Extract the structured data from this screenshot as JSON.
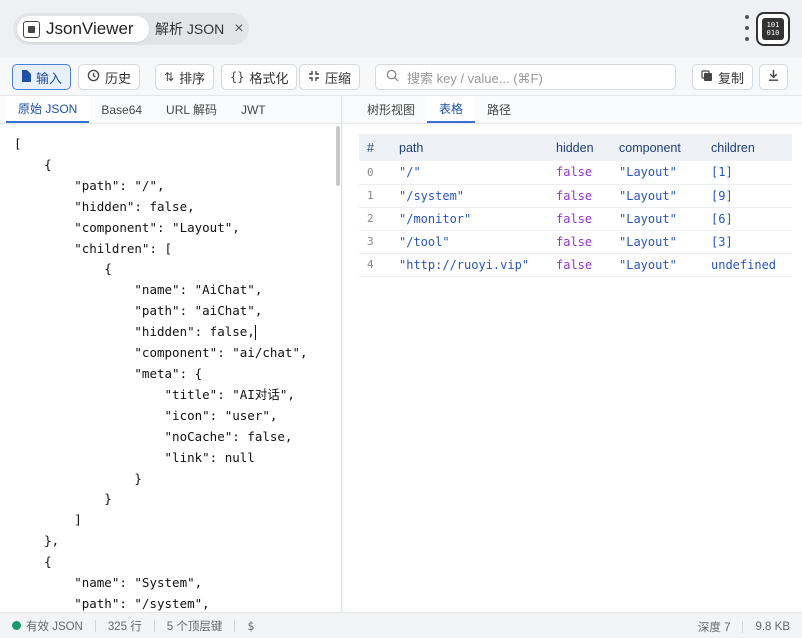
{
  "titlebar": {
    "app_title": "JsonViewer",
    "doc_tab": "解析 JSON",
    "close_glyph": "×"
  },
  "toolbar": {
    "input": "输入",
    "history": "历史",
    "sort": "排序",
    "format": "格式化",
    "compress": "压缩",
    "search_placeholder": "搜索 key / value... (⌘F)",
    "copy": "复制"
  },
  "left_tabs": [
    "原始 JSON",
    "Base64",
    "URL 解码",
    "JWT"
  ],
  "right_tabs": [
    "树形视图",
    "表格",
    "路径"
  ],
  "code_lines": [
    "[",
    "    {",
    "        \"path\": \"/\",",
    "        \"hidden\": false,",
    "        \"component\": \"Layout\",",
    "        \"children\": [",
    "            {",
    "                \"name\": \"AiChat\",",
    "                \"path\": \"aiChat\",",
    "                \"hidden\": false,",
    "                \"component\": \"ai/chat\",",
    "                \"meta\": {",
    "                    \"title\": \"AI对话\",",
    "                    \"icon\": \"user\",",
    "                    \"noCache\": false,",
    "                    \"link\": null",
    "                }",
    "            }",
    "        ]",
    "    },",
    "    {",
    "        \"name\": \"System\",",
    "        \"path\": \"/system\","
  ],
  "table": {
    "headers": [
      "#",
      "path",
      "hidden",
      "component",
      "children"
    ],
    "rows": [
      [
        "0",
        "\"/\"",
        "false",
        "\"Layout\"",
        "[1]"
      ],
      [
        "1",
        "\"/system\"",
        "false",
        "\"Layout\"",
        "[9]"
      ],
      [
        "2",
        "\"/monitor\"",
        "false",
        "\"Layout\"",
        "[6]"
      ],
      [
        "3",
        "\"/tool\"",
        "false",
        "\"Layout\"",
        "[3]"
      ],
      [
        "4",
        "\"http://ruoyi.vip\"",
        "false",
        "\"Layout\"",
        "undefined"
      ]
    ]
  },
  "status": {
    "valid": "有效 JSON",
    "lines": "325 行",
    "root_keys": "5 个顶层键",
    "dollar": "$",
    "depth": "深度 7",
    "size": "9.8 KB"
  },
  "colors": {
    "accent": "#3b6fd1",
    "valid_dot": "#1a9a6b",
    "bool": "#9333c7",
    "string": "#2a55b8"
  }
}
